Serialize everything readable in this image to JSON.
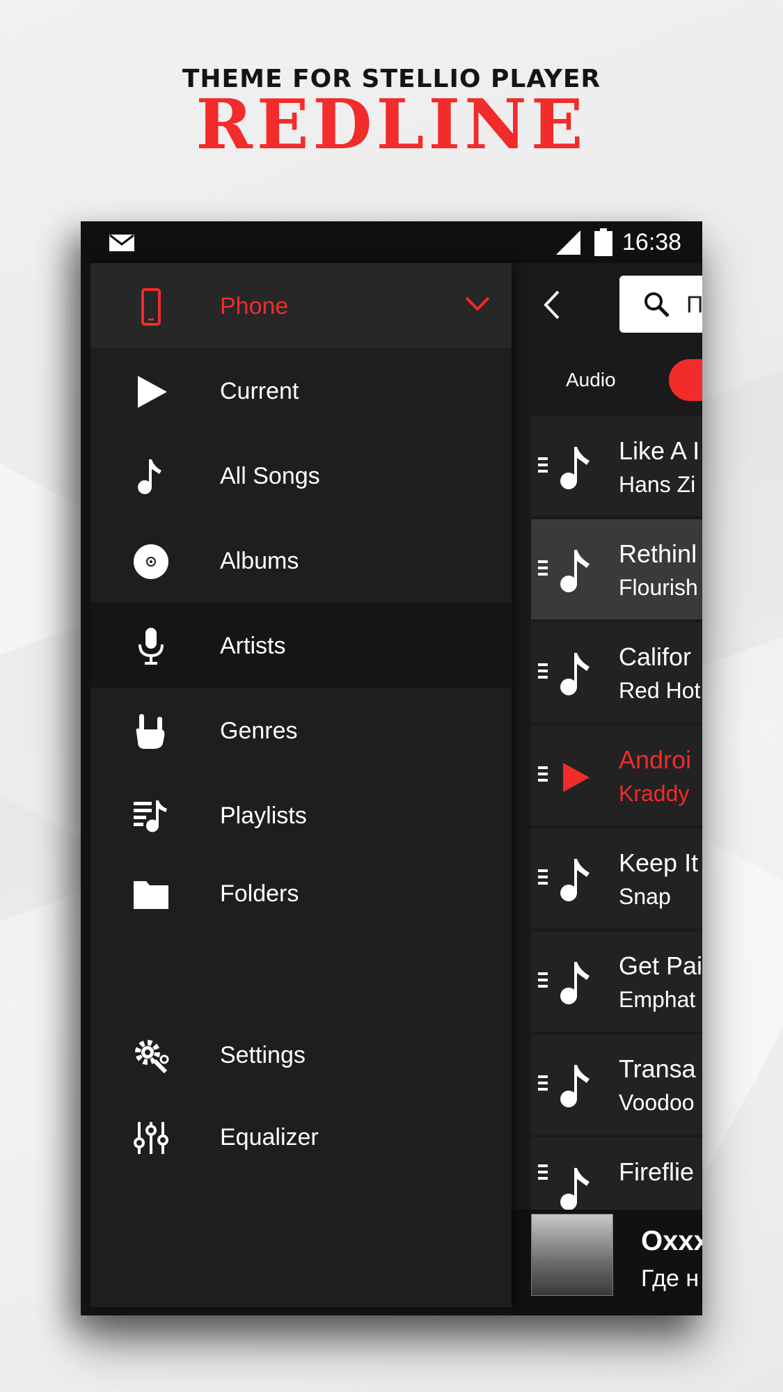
{
  "promo": {
    "subtitle": "THEME FOR STELLIO PLAYER",
    "title": "REDLINE"
  },
  "status_bar": {
    "time": "16:38",
    "icons": [
      "mail-icon",
      "signal-icon",
      "battery-icon"
    ]
  },
  "colors": {
    "accent": "#f22b2b",
    "background": "#1e1e1e",
    "statusbar": "#101010"
  },
  "drawer": {
    "header": {
      "label": "Phone",
      "icon": "phone-icon"
    },
    "items": [
      {
        "label": "Current",
        "icon": "play-icon"
      },
      {
        "label": "All Songs",
        "icon": "music-note-icon"
      },
      {
        "label": "Albums",
        "icon": "disc-icon"
      },
      {
        "label": "Artists",
        "icon": "microphone-icon",
        "active": true
      },
      {
        "label": "Genres",
        "icon": "rock-hand-icon"
      },
      {
        "label": "Playlists",
        "icon": "playlist-icon"
      },
      {
        "label": "Folders",
        "icon": "folder-icon"
      }
    ],
    "footer_items": [
      {
        "label": "Settings",
        "icon": "settings-icon"
      },
      {
        "label": "Equalizer",
        "icon": "equalizer-icon"
      }
    ]
  },
  "toolbar": {
    "search_text": "П"
  },
  "tabs": {
    "audio": "Audio"
  },
  "tracks": [
    {
      "title": "Like A I",
      "artist": "Hans Zi"
    },
    {
      "title": "Rethinl",
      "artist": "Flourish",
      "selected": true
    },
    {
      "title": "Califor",
      "artist": "Red Hot"
    },
    {
      "title": "Androi",
      "artist": "Kraddy",
      "playing": true
    },
    {
      "title": "Keep It",
      "artist": "Snap"
    },
    {
      "title": "Get Pai",
      "artist": "Emphat"
    },
    {
      "title": "Transa",
      "artist": "Voodoo"
    },
    {
      "title": "Fireflie",
      "artist": ""
    }
  ],
  "mini_player": {
    "title": "Oxxx",
    "subtitle": "Где н"
  }
}
